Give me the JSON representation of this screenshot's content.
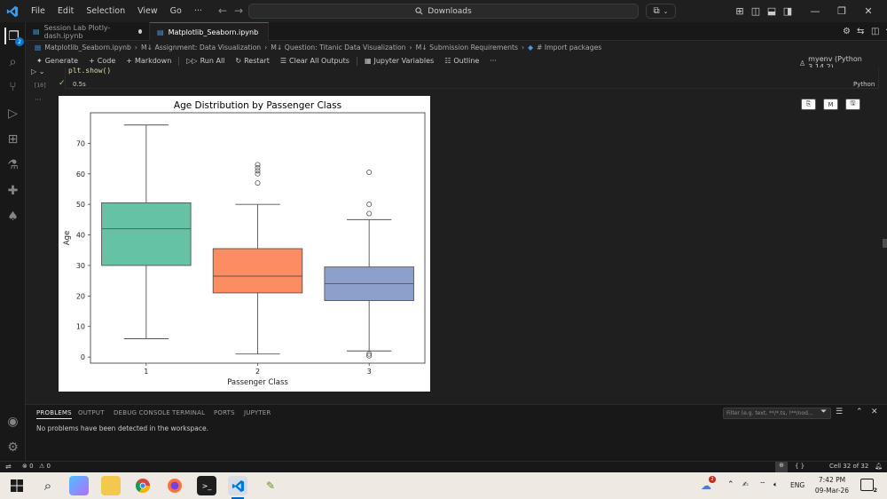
{
  "menu": {
    "items": [
      "File",
      "Edit",
      "Selection",
      "View",
      "Go",
      "···"
    ]
  },
  "search": {
    "text": "Downloads"
  },
  "activity": {
    "badge": "2"
  },
  "tabs": [
    {
      "label": "Session Lab Plotly-dash.ipynb"
    },
    {
      "label": "Matplotlib_Seaborn.ipynb"
    }
  ],
  "breadcrumb": {
    "file": "Matplotlib_Seaborn.ipynb",
    "c1": "M↓ Assignment: Data Visualization",
    "c2": "M↓ Question: Titanic Data Visualization",
    "c3": "M↓ Submission Requirements",
    "c4": "# Import packages"
  },
  "toolbar": {
    "generate": "Generate",
    "code": "Code",
    "markdown": "Markdown",
    "run_all": "Run All",
    "restart": "Restart",
    "clear": "Clear All Outputs",
    "variables": "Jupyter Variables",
    "outline": "Outline",
    "more": "···",
    "kernel": "myenv (Python 3.14.2)"
  },
  "cell": {
    "code_line": "plt.show()",
    "exec_count": "[10]",
    "time": "0.5s",
    "language": "Python",
    "output_more": "···"
  },
  "chart_data": {
    "type": "box",
    "title": "Age Distribution by Passenger Class",
    "xlabel": "Passenger Class",
    "ylabel": "Age",
    "categories": [
      "1",
      "2",
      "3"
    ],
    "yticks": [
      "0",
      "10",
      "20",
      "30",
      "40",
      "50",
      "60",
      "70"
    ],
    "ylim": [
      -2,
      80
    ],
    "boxes": [
      {
        "category": "1",
        "q1": 30,
        "median": 42,
        "q3": 50.5,
        "whisker_low": 6,
        "whisker_high": 76,
        "outliers": [],
        "color": "#66c2a5"
      },
      {
        "category": "2",
        "q1": 21,
        "median": 26.5,
        "q3": 35.5,
        "whisker_low": 1,
        "whisker_high": 50,
        "outliers": [
          57,
          60,
          61,
          62,
          63
        ],
        "color": "#fc8d62"
      },
      {
        "category": "3",
        "q1": 18.5,
        "median": 24,
        "q3": 29.5,
        "whisker_low": 2,
        "whisker_high": 45,
        "outliers": [
          47,
          50,
          60.5,
          0.4,
          1
        ],
        "color": "#8da0cb"
      }
    ]
  },
  "panel": {
    "tabs": [
      "PROBLEMS",
      "OUTPUT",
      "DEBUG CONSOLE",
      "TERMINAL",
      "PORTS",
      "JUPYTER"
    ],
    "message": "No problems have been detected in the workspace.",
    "filter_placeholder": "Filter (e.g. text, **/*.ts, !**/nod..."
  },
  "status": {
    "errors": "0",
    "warnings": "0",
    "cell": "Cell 32 of 32"
  },
  "taskbar": {
    "time": "7:42 PM",
    "date": "09-Mar-26",
    "lang": "ENG",
    "notif_count": "2"
  }
}
